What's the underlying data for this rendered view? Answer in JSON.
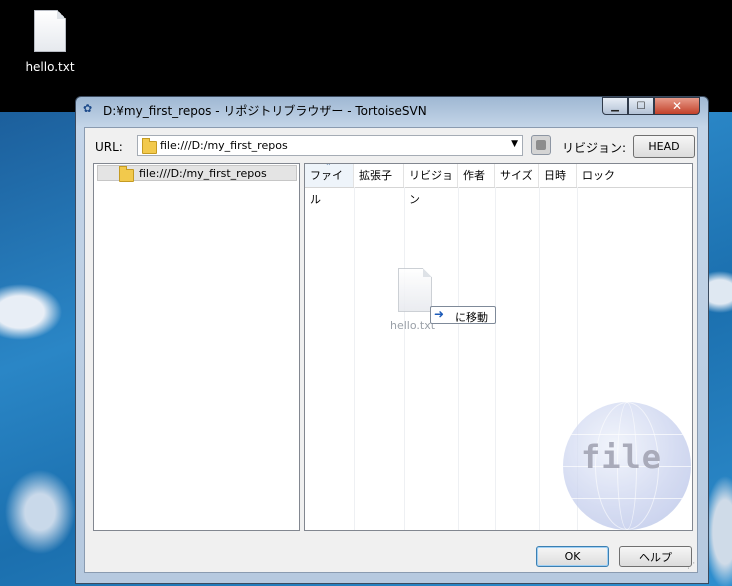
{
  "desktop": {
    "icon_label": "hello.txt",
    "icon": "text-file-icon"
  },
  "window": {
    "title": "D:¥my_first_repos - リポジトリブラウザー - TortoiseSVN",
    "title_icon": "tortoisesvn-icon",
    "controls": {
      "minimize": "minimize-icon",
      "maximize": "maximize-icon",
      "close": "close-icon"
    }
  },
  "toolbar": {
    "url_label": "URL:",
    "url_value": "file:///D:/my_first_repos",
    "revision_label": "リビジョン:",
    "revision_button": "HEAD"
  },
  "tree": {
    "root": "file:///D:/my_first_repos"
  },
  "list": {
    "columns": [
      "ファイル",
      "拡張子",
      "リビジョン",
      "作者",
      "サイズ",
      "日時",
      "ロック"
    ],
    "sorted_column": "ファイル",
    "drag_item": "hello.txt",
    "drop_tooltip": "に移動"
  },
  "watermark": {
    "text": "file"
  },
  "buttons": {
    "ok": "OK",
    "help": "ヘルプ"
  },
  "colors": {
    "accent": "#3c7fb1",
    "close_button": "#c2412a",
    "folder": "#f2c94c"
  }
}
